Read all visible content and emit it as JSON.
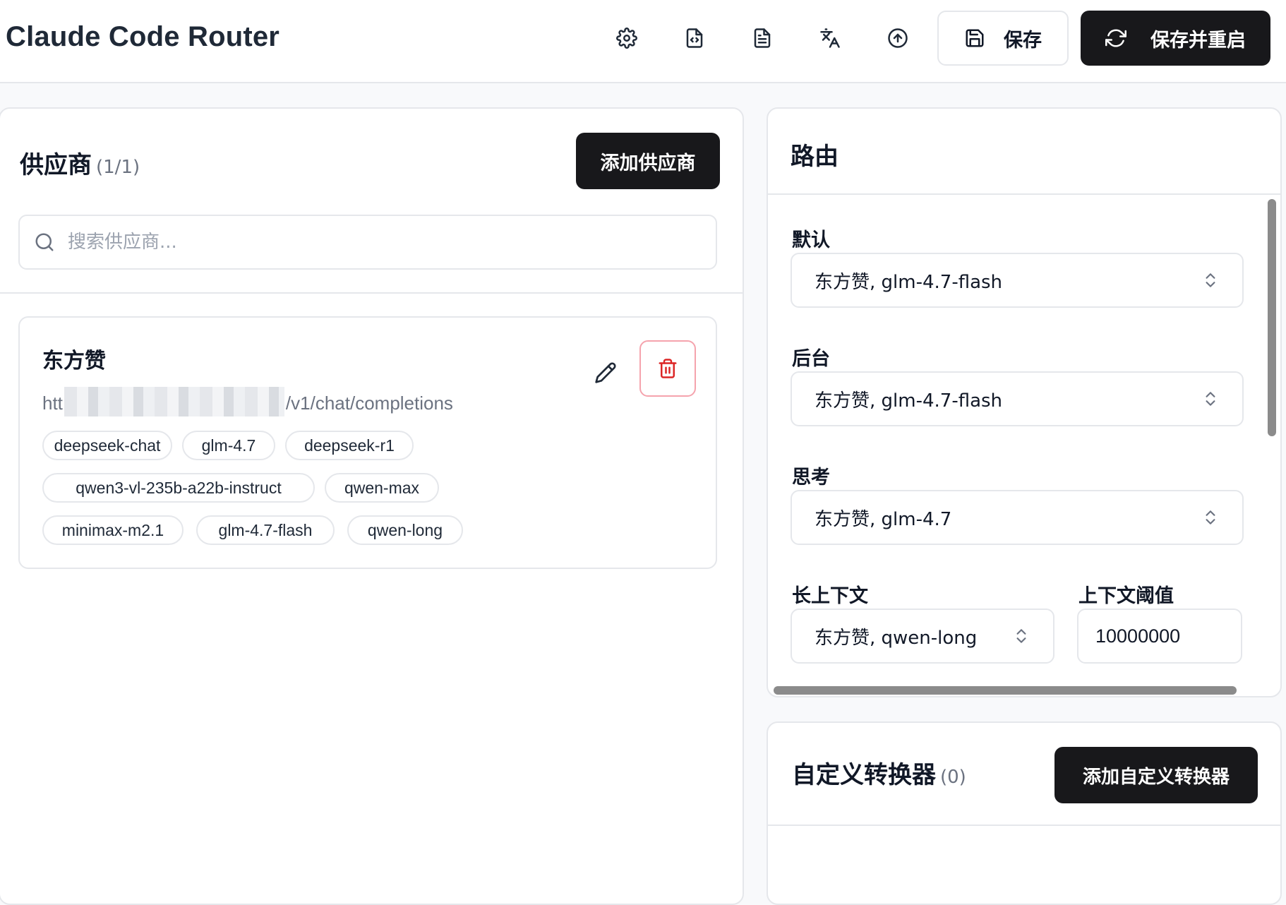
{
  "header": {
    "title": "Claude Code Router",
    "icons": [
      "gear-icon",
      "file-code-icon",
      "file-text-icon",
      "translate-icon",
      "upload-icon"
    ],
    "save_label": "保存",
    "save_restart_label": "保存并重启"
  },
  "providers": {
    "title": "供应商",
    "count": "(1/1)",
    "add_label": "添加供应商",
    "search_placeholder": "搜索供应商...",
    "items": [
      {
        "name": "东方赞",
        "url_prefix": "htt",
        "url_suffix": "/v1/chat/completions",
        "models": [
          "deepseek-chat",
          "glm-4.7",
          "deepseek-r1",
          "qwen3-vl-235b-a22b-instruct",
          "qwen-max",
          "minimax-m2.1",
          "glm-4.7-flash",
          "qwen-long"
        ]
      }
    ]
  },
  "router": {
    "title": "路由",
    "default_label": "默认",
    "default_value": "东方赞, glm-4.7-flash",
    "background_label": "后台",
    "background_value": "东方赞, glm-4.7-flash",
    "think_label": "思考",
    "think_value": "东方赞, glm-4.7",
    "long_context_label": "长上下文",
    "long_context_value": "东方赞, qwen-long",
    "threshold_label": "上下文阈值",
    "threshold_value": "10000000"
  },
  "transformers": {
    "title": "自定义转换器",
    "count": "(0)",
    "add_label": "添加自定义转换器"
  }
}
